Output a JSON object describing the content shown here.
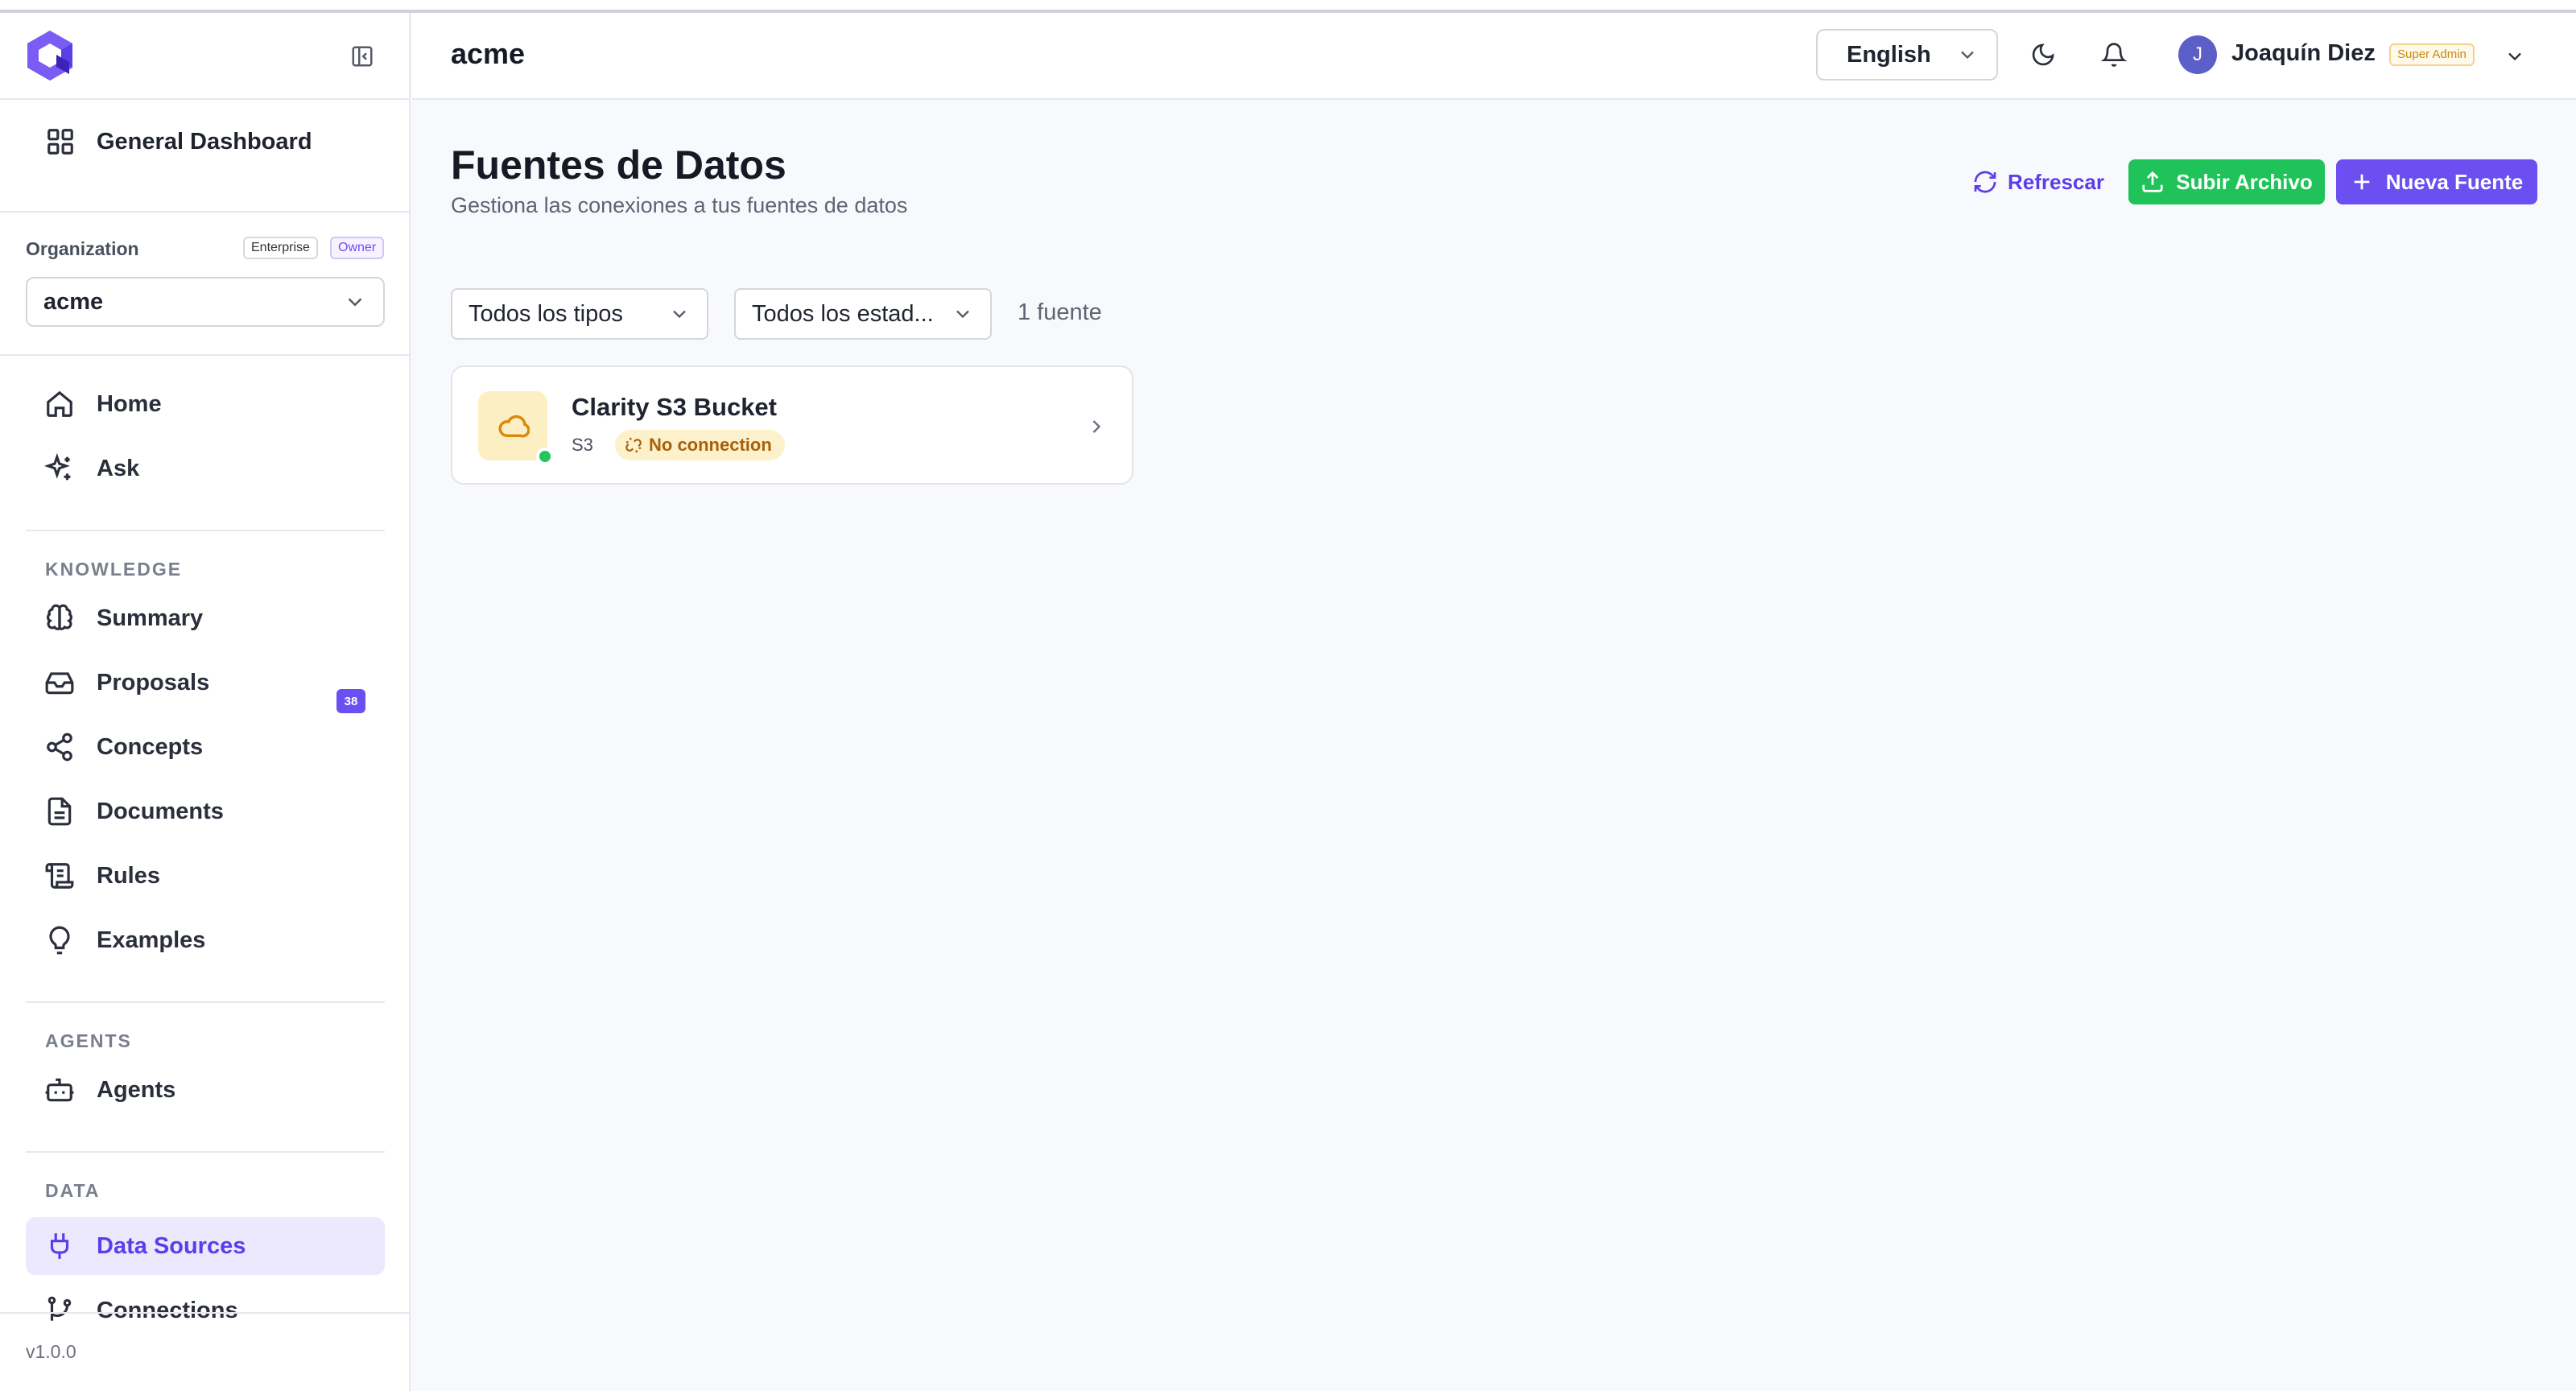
{
  "app": {
    "org_header": "acme",
    "version": "v1.0.0"
  },
  "sidebar": {
    "dashboard_label": "General Dashboard",
    "org_label": "Organization",
    "org_badges": [
      "Enterprise",
      "Owner"
    ],
    "org_value": "acme",
    "top_items": [
      {
        "label": "Home",
        "icon": "home-icon"
      },
      {
        "label": "Ask",
        "icon": "sparkles-icon"
      }
    ],
    "sections": [
      {
        "title": "KNOWLEDGE",
        "items": [
          {
            "label": "Summary",
            "icon": "brain-icon"
          },
          {
            "label": "Proposals",
            "icon": "inbox-icon",
            "badge": "38"
          },
          {
            "label": "Concepts",
            "icon": "share-icon"
          },
          {
            "label": "Documents",
            "icon": "document-icon"
          },
          {
            "label": "Rules",
            "icon": "scroll-icon"
          },
          {
            "label": "Examples",
            "icon": "lightbulb-icon"
          }
        ]
      },
      {
        "title": "AGENTS",
        "items": [
          {
            "label": "Agents",
            "icon": "bot-icon"
          }
        ]
      },
      {
        "title": "DATA",
        "items": [
          {
            "label": "Data Sources",
            "icon": "plug-icon",
            "active": true
          },
          {
            "label": "Connections",
            "icon": "git-branch-icon"
          }
        ]
      }
    ]
  },
  "header": {
    "title": "acme",
    "language": "English",
    "user": {
      "initial": "J",
      "name": "Joaquín Diez",
      "role_badge": "Super Admin"
    }
  },
  "main": {
    "title": "Fuentes de Datos",
    "subtitle": "Gestiona las conexiones a tus fuentes de datos",
    "actions": {
      "refresh": "Refrescar",
      "upload": "Subir Archivo",
      "new": "Nueva Fuente"
    },
    "filters": {
      "type": "Todos los tipos",
      "status": "Todos los estad..."
    },
    "count_text": "1 fuente",
    "sources": [
      {
        "name": "Clarity S3 Bucket",
        "type": "S3",
        "status": "No connection",
        "icon": "cloud-icon"
      }
    ]
  },
  "colors": {
    "accent": "#6b4ff0",
    "success": "#1fc35a",
    "warning_bg": "#fdf1cc",
    "warning_text": "#a8600a"
  }
}
